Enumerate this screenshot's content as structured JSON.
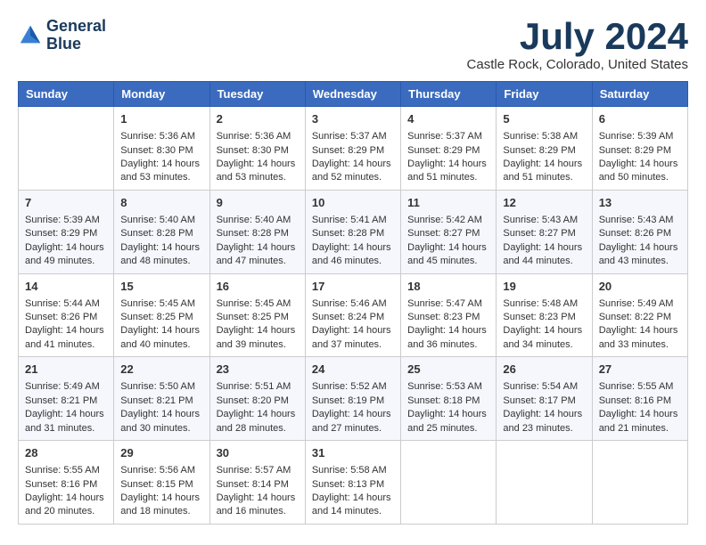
{
  "logo": {
    "line1": "General",
    "line2": "Blue"
  },
  "title": "July 2024",
  "location": "Castle Rock, Colorado, United States",
  "days_of_week": [
    "Sunday",
    "Monday",
    "Tuesday",
    "Wednesday",
    "Thursday",
    "Friday",
    "Saturday"
  ],
  "weeks": [
    [
      {
        "day": "",
        "empty": true
      },
      {
        "day": "1",
        "sunrise": "Sunrise: 5:36 AM",
        "sunset": "Sunset: 8:30 PM",
        "daylight": "Daylight: 14 hours and 53 minutes."
      },
      {
        "day": "2",
        "sunrise": "Sunrise: 5:36 AM",
        "sunset": "Sunset: 8:30 PM",
        "daylight": "Daylight: 14 hours and 53 minutes."
      },
      {
        "day": "3",
        "sunrise": "Sunrise: 5:37 AM",
        "sunset": "Sunset: 8:29 PM",
        "daylight": "Daylight: 14 hours and 52 minutes."
      },
      {
        "day": "4",
        "sunrise": "Sunrise: 5:37 AM",
        "sunset": "Sunset: 8:29 PM",
        "daylight": "Daylight: 14 hours and 51 minutes."
      },
      {
        "day": "5",
        "sunrise": "Sunrise: 5:38 AM",
        "sunset": "Sunset: 8:29 PM",
        "daylight": "Daylight: 14 hours and 51 minutes."
      },
      {
        "day": "6",
        "sunrise": "Sunrise: 5:39 AM",
        "sunset": "Sunset: 8:29 PM",
        "daylight": "Daylight: 14 hours and 50 minutes."
      }
    ],
    [
      {
        "day": "7",
        "sunrise": "Sunrise: 5:39 AM",
        "sunset": "Sunset: 8:29 PM",
        "daylight": "Daylight: 14 hours and 49 minutes."
      },
      {
        "day": "8",
        "sunrise": "Sunrise: 5:40 AM",
        "sunset": "Sunset: 8:28 PM",
        "daylight": "Daylight: 14 hours and 48 minutes."
      },
      {
        "day": "9",
        "sunrise": "Sunrise: 5:40 AM",
        "sunset": "Sunset: 8:28 PM",
        "daylight": "Daylight: 14 hours and 47 minutes."
      },
      {
        "day": "10",
        "sunrise": "Sunrise: 5:41 AM",
        "sunset": "Sunset: 8:28 PM",
        "daylight": "Daylight: 14 hours and 46 minutes."
      },
      {
        "day": "11",
        "sunrise": "Sunrise: 5:42 AM",
        "sunset": "Sunset: 8:27 PM",
        "daylight": "Daylight: 14 hours and 45 minutes."
      },
      {
        "day": "12",
        "sunrise": "Sunrise: 5:43 AM",
        "sunset": "Sunset: 8:27 PM",
        "daylight": "Daylight: 14 hours and 44 minutes."
      },
      {
        "day": "13",
        "sunrise": "Sunrise: 5:43 AM",
        "sunset": "Sunset: 8:26 PM",
        "daylight": "Daylight: 14 hours and 43 minutes."
      }
    ],
    [
      {
        "day": "14",
        "sunrise": "Sunrise: 5:44 AM",
        "sunset": "Sunset: 8:26 PM",
        "daylight": "Daylight: 14 hours and 41 minutes."
      },
      {
        "day": "15",
        "sunrise": "Sunrise: 5:45 AM",
        "sunset": "Sunset: 8:25 PM",
        "daylight": "Daylight: 14 hours and 40 minutes."
      },
      {
        "day": "16",
        "sunrise": "Sunrise: 5:45 AM",
        "sunset": "Sunset: 8:25 PM",
        "daylight": "Daylight: 14 hours and 39 minutes."
      },
      {
        "day": "17",
        "sunrise": "Sunrise: 5:46 AM",
        "sunset": "Sunset: 8:24 PM",
        "daylight": "Daylight: 14 hours and 37 minutes."
      },
      {
        "day": "18",
        "sunrise": "Sunrise: 5:47 AM",
        "sunset": "Sunset: 8:23 PM",
        "daylight": "Daylight: 14 hours and 36 minutes."
      },
      {
        "day": "19",
        "sunrise": "Sunrise: 5:48 AM",
        "sunset": "Sunset: 8:23 PM",
        "daylight": "Daylight: 14 hours and 34 minutes."
      },
      {
        "day": "20",
        "sunrise": "Sunrise: 5:49 AM",
        "sunset": "Sunset: 8:22 PM",
        "daylight": "Daylight: 14 hours and 33 minutes."
      }
    ],
    [
      {
        "day": "21",
        "sunrise": "Sunrise: 5:49 AM",
        "sunset": "Sunset: 8:21 PM",
        "daylight": "Daylight: 14 hours and 31 minutes."
      },
      {
        "day": "22",
        "sunrise": "Sunrise: 5:50 AM",
        "sunset": "Sunset: 8:21 PM",
        "daylight": "Daylight: 14 hours and 30 minutes."
      },
      {
        "day": "23",
        "sunrise": "Sunrise: 5:51 AM",
        "sunset": "Sunset: 8:20 PM",
        "daylight": "Daylight: 14 hours and 28 minutes."
      },
      {
        "day": "24",
        "sunrise": "Sunrise: 5:52 AM",
        "sunset": "Sunset: 8:19 PM",
        "daylight": "Daylight: 14 hours and 27 minutes."
      },
      {
        "day": "25",
        "sunrise": "Sunrise: 5:53 AM",
        "sunset": "Sunset: 8:18 PM",
        "daylight": "Daylight: 14 hours and 25 minutes."
      },
      {
        "day": "26",
        "sunrise": "Sunrise: 5:54 AM",
        "sunset": "Sunset: 8:17 PM",
        "daylight": "Daylight: 14 hours and 23 minutes."
      },
      {
        "day": "27",
        "sunrise": "Sunrise: 5:55 AM",
        "sunset": "Sunset: 8:16 PM",
        "daylight": "Daylight: 14 hours and 21 minutes."
      }
    ],
    [
      {
        "day": "28",
        "sunrise": "Sunrise: 5:55 AM",
        "sunset": "Sunset: 8:16 PM",
        "daylight": "Daylight: 14 hours and 20 minutes."
      },
      {
        "day": "29",
        "sunrise": "Sunrise: 5:56 AM",
        "sunset": "Sunset: 8:15 PM",
        "daylight": "Daylight: 14 hours and 18 minutes."
      },
      {
        "day": "30",
        "sunrise": "Sunrise: 5:57 AM",
        "sunset": "Sunset: 8:14 PM",
        "daylight": "Daylight: 14 hours and 16 minutes."
      },
      {
        "day": "31",
        "sunrise": "Sunrise: 5:58 AM",
        "sunset": "Sunset: 8:13 PM",
        "daylight": "Daylight: 14 hours and 14 minutes."
      },
      {
        "day": "",
        "empty": true
      },
      {
        "day": "",
        "empty": true
      },
      {
        "day": "",
        "empty": true
      }
    ]
  ]
}
